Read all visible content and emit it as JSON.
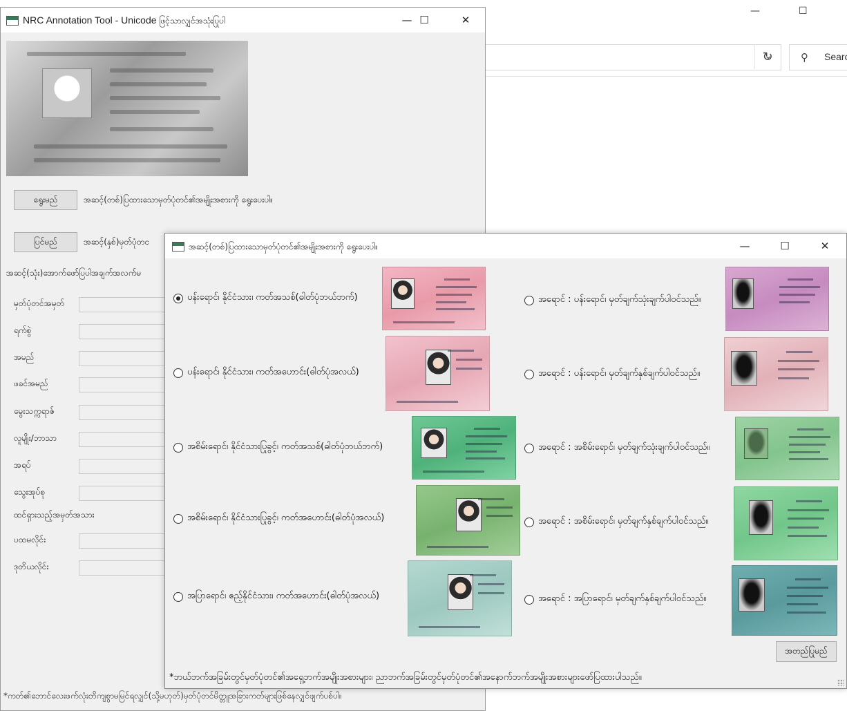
{
  "bg_window": {
    "search_placeholder": "Search"
  },
  "main_window": {
    "title_en": "NRC Annotation Tool - Unicode ",
    "title_mm": "ဖြင့်သာလျှင်အသုံးပြုပါ",
    "select_button": "ရွေးမည်",
    "select_hint": "အဆင့်(တစ်)ပြထားသောမှတ်ပုံတင်၏အမျိုးအစားကို ရွေးပေးပါ။",
    "fix_button": "ပြင်မည်",
    "fix_hint": "အဆင့်(နှစ်)မှတ်ပုံတင",
    "step3_hint": "အဆင့်(သုံး)အောက်ဖော်ပြပါအချက်အလက်မ",
    "fields": [
      {
        "label": "မှတ်ပုံတင်အမှတ်"
      },
      {
        "label": "ရက်စွဲ"
      },
      {
        "label": "အမည်"
      },
      {
        "label": "ဖခင်အမည်"
      },
      {
        "label": "မွေးသက္ကရာဇ်"
      },
      {
        "label": "လူမျိုး/ဘာသာ"
      },
      {
        "label": "အရပ်"
      },
      {
        "label": "သွေးအုပ်စု"
      },
      {
        "label": "ထင်ရှားသည့်အမှတ်အသား"
      },
      {
        "label": "ပထမလိုင်း"
      },
      {
        "label": "ဒုတိယလိုင်း"
      }
    ],
    "footnote": "*ကတ်၏ဘောင်လေးဖက်လုံးတိကျစွာမမြင်ရလျှင်(သို့မဟုတ်)မှတ်ပုံတင်မိတ္တူအခြားကတ်များဖြစ်နေလျှင်ဖျက်ပစ်ပါ။"
  },
  "dialog": {
    "title": "အဆင့်(တစ်)ပြထားသောမှတ်ပုံတင်၏အမျိုးအစားကို ရွေးပေးပါ။",
    "options_left": [
      {
        "label": "ပန်းရောင်၊ နိုင်ငံသား၊ ကတ်အသစ်(ဓါတ်ပုံဘယ်ဘက်)",
        "selected": true
      },
      {
        "label": "ပန်းရောင်၊ နိုင်ငံသား၊ ကတ်အဟောင်း(ဓါတ်ပုံအလယ်)",
        "selected": false
      },
      {
        "label": "အစိမ်းရောင်၊ နိုင်ငံသားပြုခွင့်၊ ကတ်အသစ်(ဓါတ်ပုံဘယ်ဘက်)",
        "selected": false
      },
      {
        "label": "အစိမ်းရောင်၊ နိုင်ငံသားပြုခွင့်၊ ကတ်အဟောင်း(ဓါတ်ပုံအလယ်)",
        "selected": false
      },
      {
        "label": "အပြာရောင်၊ ဧည့်နိုင်ငံသား၊ ကတ်အဟောင်း(ဓါတ်ပုံအလယ်)",
        "selected": false
      }
    ],
    "options_right": [
      {
        "label": "အရောင် : ပန်းရောင်၊ မှတ်ချက်သုံးချက်ပါဝင်သည်။",
        "selected": false
      },
      {
        "label": "အရောင် : ပန်းရောင်၊ မှတ်ချက်နှစ်ချက်ပါဝင်သည်။",
        "selected": false
      },
      {
        "label": "အရောင် : အစိမ်းရောင်၊ မှတ်ချက်သုံးချက်ပါဝင်သည်။",
        "selected": false
      },
      {
        "label": "အရောင် : အစိမ်းရောင်၊ မှတ်ချက်နှစ်ချက်ပါဝင်သည်။",
        "selected": false
      },
      {
        "label": "အရောင် : အပြာရောင်၊ မှတ်ချက်နှစ်ချက်ပါဝင်သည်။",
        "selected": false
      }
    ],
    "confirm_button": "အတည်ပြုမည်",
    "note": "*ဘယ်ဘက်အခြမ်းတွင်မှတ်ပုံတင်၏အရှေ့ဘက်အမျိုးအစားများ၊ ညာဘက်အခြမ်းတွင်မှတ်ပုံတင်၏အနောက်ဘက်အမျိုးအစားများဖော်ပြထားပါသည်။"
  }
}
